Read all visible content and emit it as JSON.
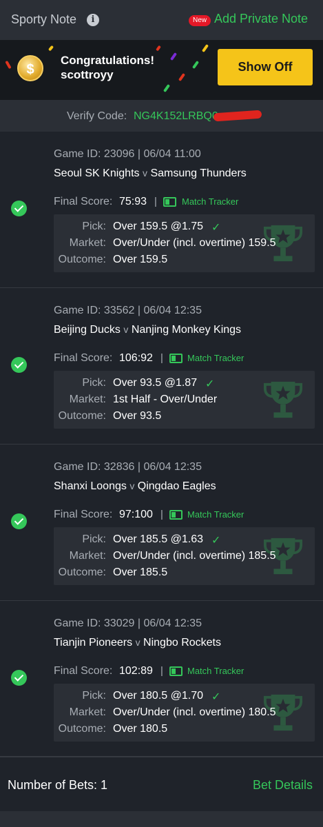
{
  "header": {
    "title": "Sporty Note",
    "new_badge": "New",
    "add_note": "Add Private Note"
  },
  "congrats": {
    "line1": "Congratulations!",
    "line2": "scottroyy",
    "button": "Show Off",
    "coin_symbol": "$"
  },
  "verify": {
    "label": "Verify Code:",
    "code": "NG4K152LRBQ0"
  },
  "colors": {
    "accent_green": "#35c75a",
    "button_yellow": "#f5c419",
    "badge_red": "#e41827"
  },
  "bets": [
    {
      "game_id": "Game ID: 23096 | 06/04 11:00",
      "home": "Seoul SK Knights",
      "away": "Samsung Thunders",
      "vs": "v",
      "final_label": "Final Score:",
      "score": "75:93",
      "sep": "|",
      "tracker": "Match Tracker",
      "pick_label": "Pick:",
      "pick": "Over 159.5 @1.75",
      "market_label": "Market:",
      "market": "Over/Under (incl. overtime) 159.5",
      "outcome_label": "Outcome:",
      "outcome": "Over 159.5",
      "tick": "✓"
    },
    {
      "game_id": "Game ID: 33562 | 06/04 12:35",
      "home": "Beijing Ducks",
      "away": "Nanjing Monkey Kings",
      "vs": "v",
      "final_label": "Final Score:",
      "score": "106:92",
      "sep": "|",
      "tracker": "Match Tracker",
      "pick_label": "Pick:",
      "pick": "Over 93.5 @1.87",
      "market_label": "Market:",
      "market": "1st Half - Over/Under",
      "outcome_label": "Outcome:",
      "outcome": "Over 93.5",
      "tick": "✓"
    },
    {
      "game_id": "Game ID: 32836 | 06/04 12:35",
      "home": "Shanxi Loongs",
      "away": "Qingdao Eagles",
      "vs": "v",
      "final_label": "Final Score:",
      "score": "97:100",
      "sep": "|",
      "tracker": "Match Tracker",
      "pick_label": "Pick:",
      "pick": "Over 185.5 @1.63",
      "market_label": "Market:",
      "market": "Over/Under (incl. overtime) 185.5",
      "outcome_label": "Outcome:",
      "outcome": "Over 185.5",
      "tick": "✓"
    },
    {
      "game_id": "Game ID: 33029 | 06/04 12:35",
      "home": "Tianjin Pioneers",
      "away": "Ningbo Rockets",
      "vs": "v",
      "final_label": "Final Score:",
      "score": "102:89",
      "sep": "|",
      "tracker": "Match Tracker",
      "pick_label": "Pick:",
      "pick": "Over 180.5 @1.70",
      "market_label": "Market:",
      "market": "Over/Under (incl. overtime) 180.5",
      "outcome_label": "Outcome:",
      "outcome": "Over 180.5",
      "tick": "✓"
    }
  ],
  "footer": {
    "number_of_bets": "Number of Bets: 1",
    "bet_details": "Bet Details"
  }
}
